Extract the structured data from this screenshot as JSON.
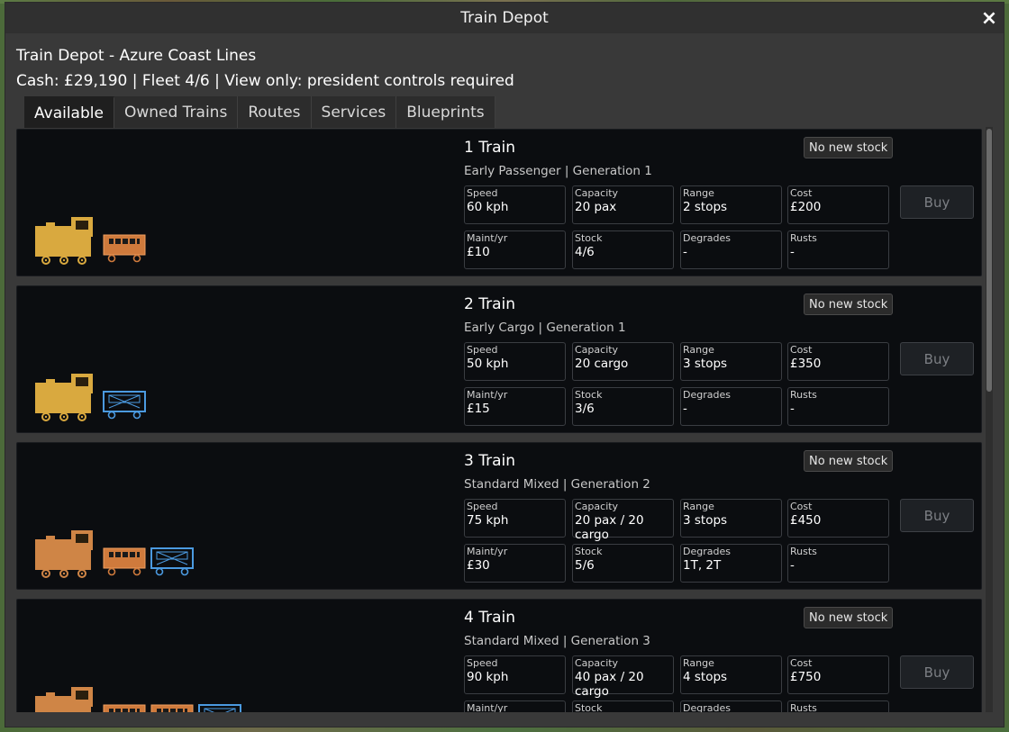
{
  "window": {
    "title": "Train Depot",
    "close_glyph": "×"
  },
  "header": {
    "title": "Train Depot - Azure Coast Lines",
    "info": "Cash: £29,190 | Fleet 4/6 | View only: president controls required"
  },
  "tabs": [
    {
      "label": "Available",
      "active": true
    },
    {
      "label": "Owned Trains",
      "active": false
    },
    {
      "label": "Routes",
      "active": false
    },
    {
      "label": "Services",
      "active": false
    },
    {
      "label": "Blueprints",
      "active": false
    }
  ],
  "colors": {
    "engine_yellow": "#d9a93f",
    "engine_orange": "#cf8546",
    "passenger_car": "#cf7a3c",
    "cargo_car_border": "#4b9ae0"
  },
  "trains": [
    {
      "name": "1 Train",
      "subtitle": "Early Passenger | Generation 1",
      "stock_badge": "No new stock",
      "buy_label": "Buy",
      "engine_color": "yellow",
      "cars": [
        "passenger"
      ],
      "stats": [
        {
          "label": "Speed",
          "value": "60 kph"
        },
        {
          "label": "Capacity",
          "value": "20 pax"
        },
        {
          "label": "Range",
          "value": "2 stops"
        },
        {
          "label": "Cost",
          "value": "£200"
        },
        {
          "label": "Maint/yr",
          "value": "£10"
        },
        {
          "label": "Stock",
          "value": "4/6"
        },
        {
          "label": "Degrades",
          "value": "-"
        },
        {
          "label": "Rusts",
          "value": "-"
        }
      ]
    },
    {
      "name": "2 Train",
      "subtitle": "Early Cargo | Generation 1",
      "stock_badge": "No new stock",
      "buy_label": "Buy",
      "engine_color": "yellow",
      "cars": [
        "cargo"
      ],
      "stats": [
        {
          "label": "Speed",
          "value": "50 kph"
        },
        {
          "label": "Capacity",
          "value": "20 cargo"
        },
        {
          "label": "Range",
          "value": "3 stops"
        },
        {
          "label": "Cost",
          "value": "£350"
        },
        {
          "label": "Maint/yr",
          "value": "£15"
        },
        {
          "label": "Stock",
          "value": "3/6"
        },
        {
          "label": "Degrades",
          "value": "-"
        },
        {
          "label": "Rusts",
          "value": "-"
        }
      ]
    },
    {
      "name": "3 Train",
      "subtitle": "Standard Mixed | Generation 2",
      "stock_badge": "No new stock",
      "buy_label": "Buy",
      "engine_color": "orange",
      "cars": [
        "passenger",
        "cargo"
      ],
      "stats": [
        {
          "label": "Speed",
          "value": "75 kph"
        },
        {
          "label": "Capacity",
          "value": "20 pax / 20 cargo"
        },
        {
          "label": "Range",
          "value": "3 stops"
        },
        {
          "label": "Cost",
          "value": "£450"
        },
        {
          "label": "Maint/yr",
          "value": "£30"
        },
        {
          "label": "Stock",
          "value": "5/6"
        },
        {
          "label": "Degrades",
          "value": "1T, 2T"
        },
        {
          "label": "Rusts",
          "value": "-"
        }
      ]
    },
    {
      "name": "4 Train",
      "subtitle": "Standard Mixed | Generation 3",
      "stock_badge": "No new stock",
      "buy_label": "Buy",
      "engine_color": "orange",
      "cars": [
        "passenger",
        "passenger",
        "cargo"
      ],
      "stats": [
        {
          "label": "Speed",
          "value": "90 kph"
        },
        {
          "label": "Capacity",
          "value": "40 pax / 20 cargo"
        },
        {
          "label": "Range",
          "value": "4 stops"
        },
        {
          "label": "Cost",
          "value": "£750"
        },
        {
          "label": "Maint/yr",
          "value": ""
        },
        {
          "label": "Stock",
          "value": ""
        },
        {
          "label": "Degrades",
          "value": ""
        },
        {
          "label": "Rusts",
          "value": ""
        }
      ]
    }
  ]
}
